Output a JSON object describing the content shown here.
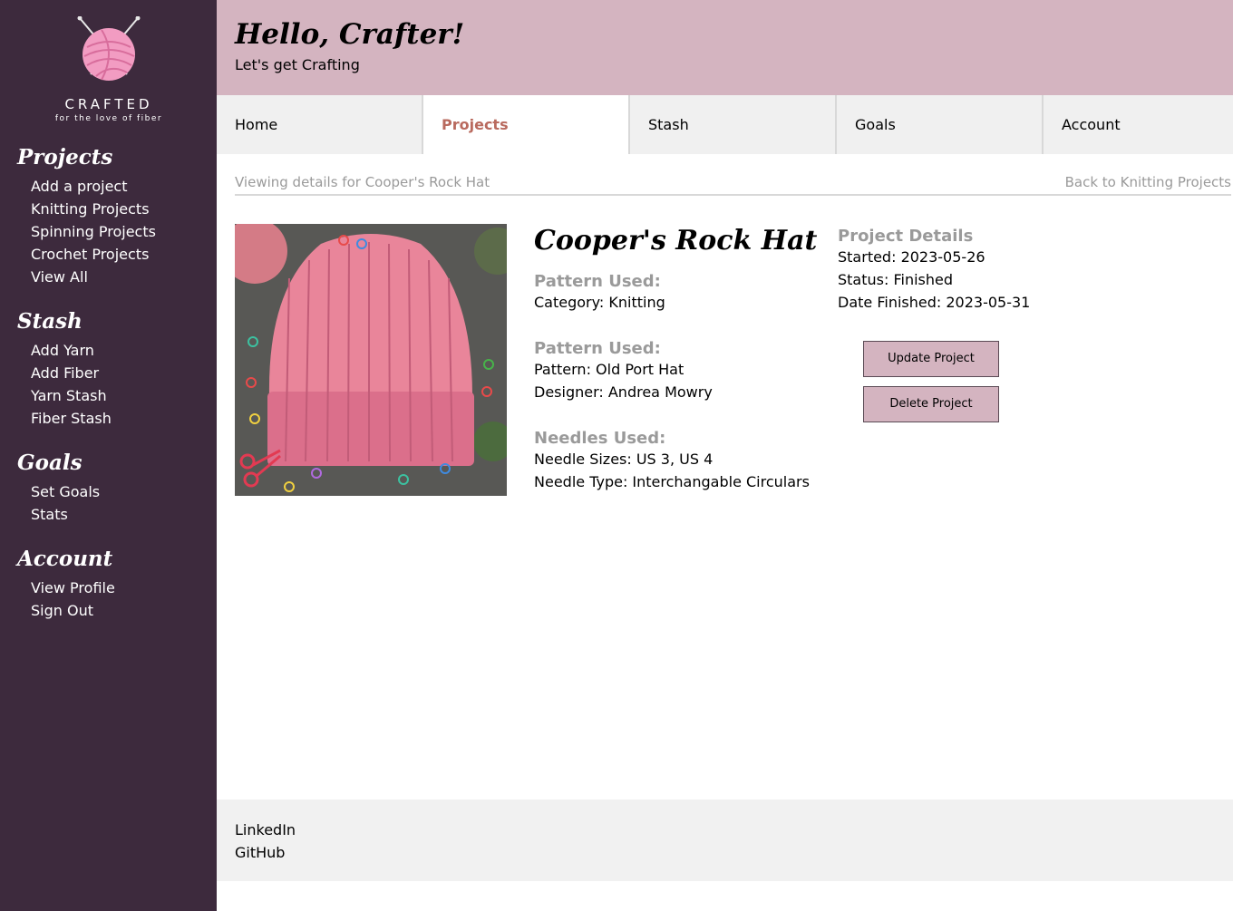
{
  "colors": {
    "sidebar_bg": "#3d2a3d",
    "header_bg": "#d4b4c0",
    "active_tab": "#b96a5e",
    "muted_text": "#9a9a9a",
    "button_bg": "#d4b4c0"
  },
  "logo": {
    "word": "CRAFTED",
    "tagline": "for the love of fiber",
    "icon": "yarn-ball-with-needles-icon"
  },
  "sidebar": {
    "sections": [
      {
        "heading": "Projects",
        "links": [
          "Add a project",
          "Knitting Projects",
          "Spinning Projects",
          "Crochet Projects",
          "View All"
        ]
      },
      {
        "heading": "Stash",
        "links": [
          "Add Yarn",
          "Add Fiber",
          "Yarn Stash",
          "Fiber Stash"
        ]
      },
      {
        "heading": "Goals",
        "links": [
          "Set Goals",
          "Stats"
        ]
      },
      {
        "heading": "Account",
        "links": [
          "View Profile",
          "Sign Out"
        ]
      }
    ]
  },
  "header": {
    "greeting": "Hello, Crafter!",
    "subtitle": "Let's get Crafting"
  },
  "tabs": [
    {
      "label": "Home",
      "active": false
    },
    {
      "label": "Projects",
      "active": true
    },
    {
      "label": "Stash",
      "active": false
    },
    {
      "label": "Goals",
      "active": false
    },
    {
      "label": "Account",
      "active": false
    }
  ],
  "breadcrumb": {
    "viewing": "Viewing details for Cooper's Rock Hat",
    "back": "Back to Knitting Projects"
  },
  "project": {
    "title": "Cooper's Rock Hat",
    "photo": "pink-knitted-hat-photo",
    "category_heading": "Pattern Used:",
    "category": "Category: Knitting",
    "pattern_heading": "Pattern Used:",
    "pattern": "Pattern: Old Port Hat",
    "designer": "Designer: Andrea Mowry",
    "needles_heading": "Needles Used:",
    "needle_sizes": "Needle Sizes: US 3, US 4",
    "needle_type": "Needle Type: Interchangable Circulars"
  },
  "details": {
    "heading": "Project Details",
    "started": "Started: 2023-05-26",
    "status": "Status: Finished",
    "finished": "Date Finished: 2023-05-31"
  },
  "actions": {
    "update": "Update Project",
    "delete": "Delete Project"
  },
  "footer": {
    "links": [
      "LinkedIn",
      "GitHub"
    ]
  }
}
